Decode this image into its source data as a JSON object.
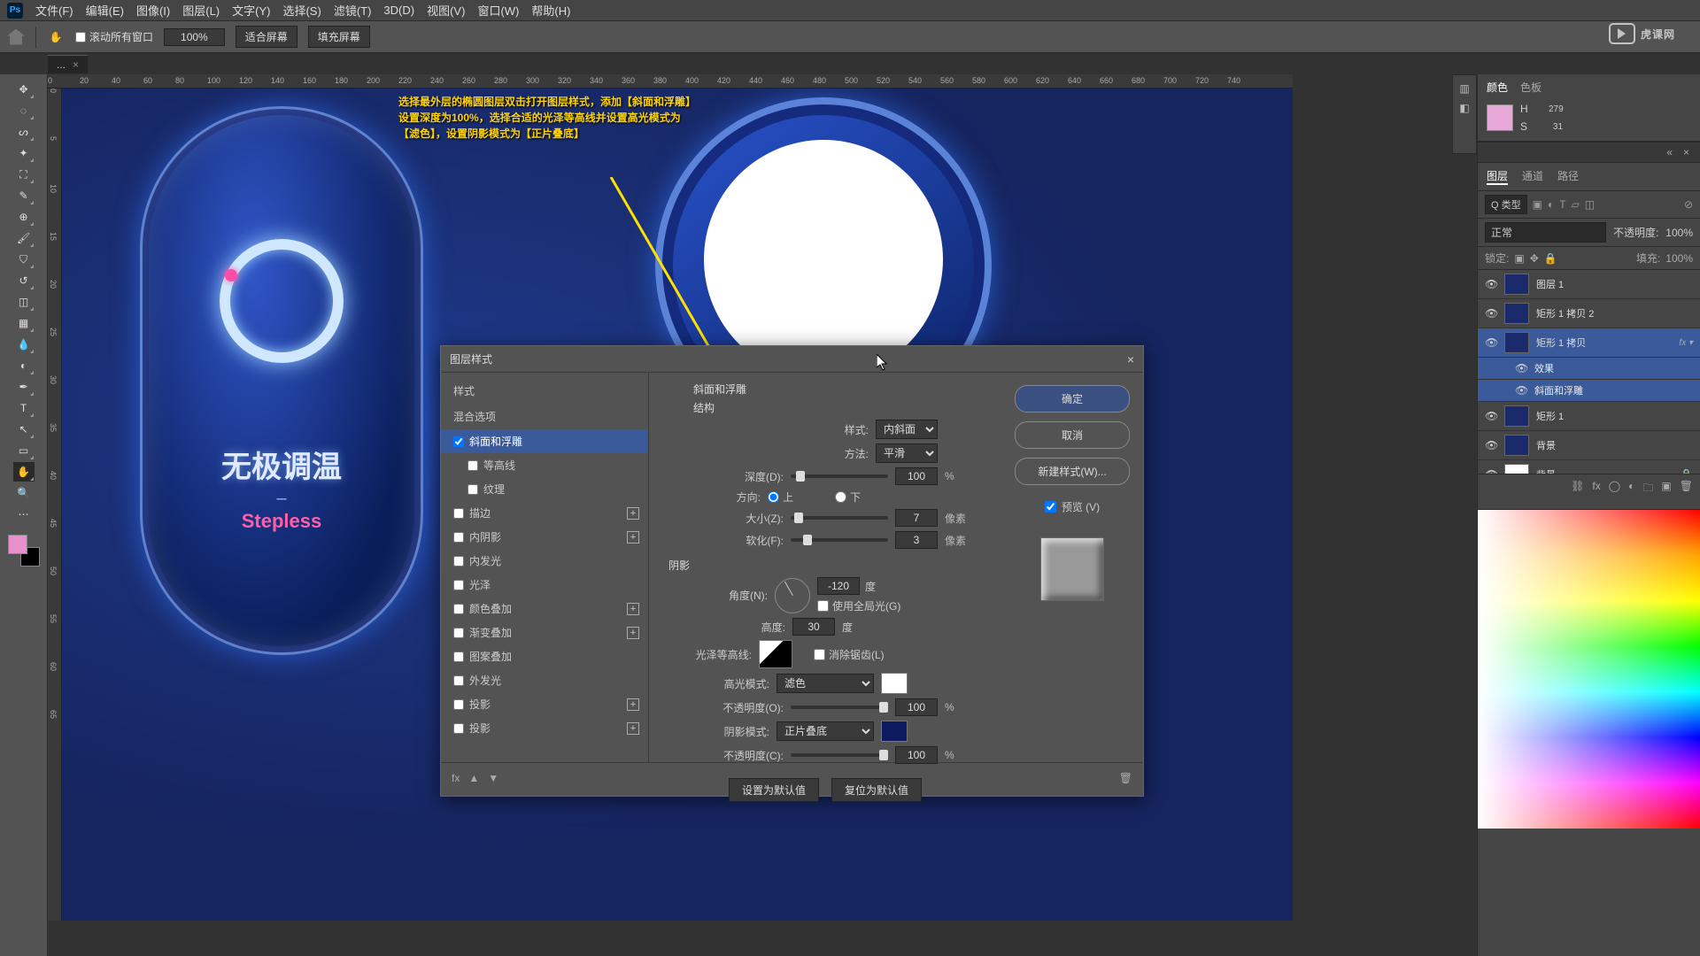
{
  "menu": {
    "items": [
      "文件(F)",
      "编辑(E)",
      "图像(I)",
      "图层(L)",
      "文字(Y)",
      "选择(S)",
      "滤镜(T)",
      "3D(D)",
      "视图(V)",
      "窗口(W)",
      "帮助(H)"
    ],
    "ps": "Ps"
  },
  "options": {
    "scroll_all": "滚动所有窗口",
    "zoom": "100%",
    "fit": "适合屏幕",
    "fill": "填充屏幕"
  },
  "tab": {
    "name": "...",
    "close": "×"
  },
  "ruler_h": [
    0,
    20,
    40,
    60,
    80,
    100,
    120,
    140,
    160,
    180,
    200,
    220,
    240,
    260,
    280,
    300,
    320,
    340,
    360,
    380,
    400,
    420,
    440,
    460,
    480,
    500,
    520,
    540,
    560,
    580,
    600,
    620,
    640,
    660,
    680,
    700,
    720,
    740
  ],
  "ruler_v": [
    0,
    5,
    10,
    15,
    20,
    25,
    30,
    35,
    40,
    45,
    50,
    55,
    60,
    65
  ],
  "canvas": {
    "title": "无极调温",
    "dash": "–",
    "subtitle": "Stepless",
    "annot_l1": "选择最外层的椭圆图层双击打开图层样式，添加【斜面和浮雕】",
    "annot_l2": "设置深度为100%，选择合适的光泽等高线并设置高光模式为",
    "annot_l3": "【滤色】，设置阴影模式为【正片叠底】"
  },
  "dialog": {
    "title": "图层样式",
    "close": "×",
    "styles_hdr": "样式",
    "blend_hdr": "混合选项",
    "effects": [
      {
        "label": "斜面和浮雕",
        "chk": true,
        "sel": true
      },
      {
        "label": "等高线",
        "chk": false,
        "indent": true
      },
      {
        "label": "纹理",
        "chk": false,
        "indent": true
      },
      {
        "label": "描边",
        "chk": false,
        "plus": true
      },
      {
        "label": "内阴影",
        "chk": false,
        "plus": true
      },
      {
        "label": "内发光",
        "chk": false
      },
      {
        "label": "光泽",
        "chk": false
      },
      {
        "label": "颜色叠加",
        "chk": false,
        "plus": true
      },
      {
        "label": "渐变叠加",
        "chk": false,
        "plus": true
      },
      {
        "label": "图案叠加",
        "chk": false
      },
      {
        "label": "外发光",
        "chk": false
      },
      {
        "label": "投影",
        "chk": false,
        "plus": true
      },
      {
        "label": "投影",
        "chk": false,
        "plus": true
      }
    ],
    "section1": "斜面和浮雕",
    "section1b": "结构",
    "style_lbl": "样式:",
    "style_val": "内斜面",
    "method_lbl": "方法:",
    "method_val": "平滑",
    "depth_lbl": "深度(D):",
    "depth_val": "100",
    "pct": "%",
    "dir_lbl": "方向:",
    "dir_up": "上",
    "dir_down": "下",
    "size_lbl": "大小(Z):",
    "size_val": "7",
    "px": "像素",
    "soft_lbl": "软化(F):",
    "soft_val": "3",
    "section2": "阴影",
    "angle_lbl": "角度(N):",
    "angle_val": "-120",
    "deg": "度",
    "global_lbl": "使用全局光(G)",
    "alt_lbl": "高度:",
    "alt_val": "30",
    "gloss_lbl": "光泽等高线:",
    "aa_lbl": "消除锯齿(L)",
    "hi_lbl": "高光模式:",
    "hi_val": "滤色",
    "hi_op_lbl": "不透明度(O):",
    "hi_op": "100",
    "sh_lbl": "阴影模式:",
    "sh_val": "正片叠底",
    "sh_op_lbl": "不透明度(C):",
    "sh_op": "100",
    "hi_color": "#ffffff",
    "sh_color": "#0e1a60",
    "default_btn": "设置为默认值",
    "reset_btn": "复位为默认值",
    "ok": "确定",
    "cancel": "取消",
    "newstyle": "新建样式(W)...",
    "preview": "预览 (V)",
    "fx": "fx"
  },
  "color_panel": {
    "tab1": "颜色",
    "tab2": "色板",
    "h": "H",
    "s": "S",
    "hv": "279",
    "sv": "31"
  },
  "layers": {
    "tab1": "图层",
    "tab2": "通道",
    "tab3": "路径",
    "kind": "Q 类型",
    "blend": "正常",
    "opacity_lbl": "不透明度:",
    "opacity": "100%",
    "lock_lbl": "锁定:",
    "fill_lbl": "填充:",
    "fill": "100%",
    "items": [
      {
        "name": "图层 1"
      },
      {
        "name": "矩形 1 拷贝 2"
      },
      {
        "name": "矩形 1 拷贝",
        "sel": true,
        "fx": true
      },
      {
        "name": "效果",
        "sub": true
      },
      {
        "name": "斜面和浮雕",
        "sub": true
      },
      {
        "name": "矩形 1"
      },
      {
        "name": "背景",
        "bgblue": true
      },
      {
        "name": "背景",
        "white": true,
        "lock": true
      }
    ]
  },
  "watermark": "虎课网"
}
